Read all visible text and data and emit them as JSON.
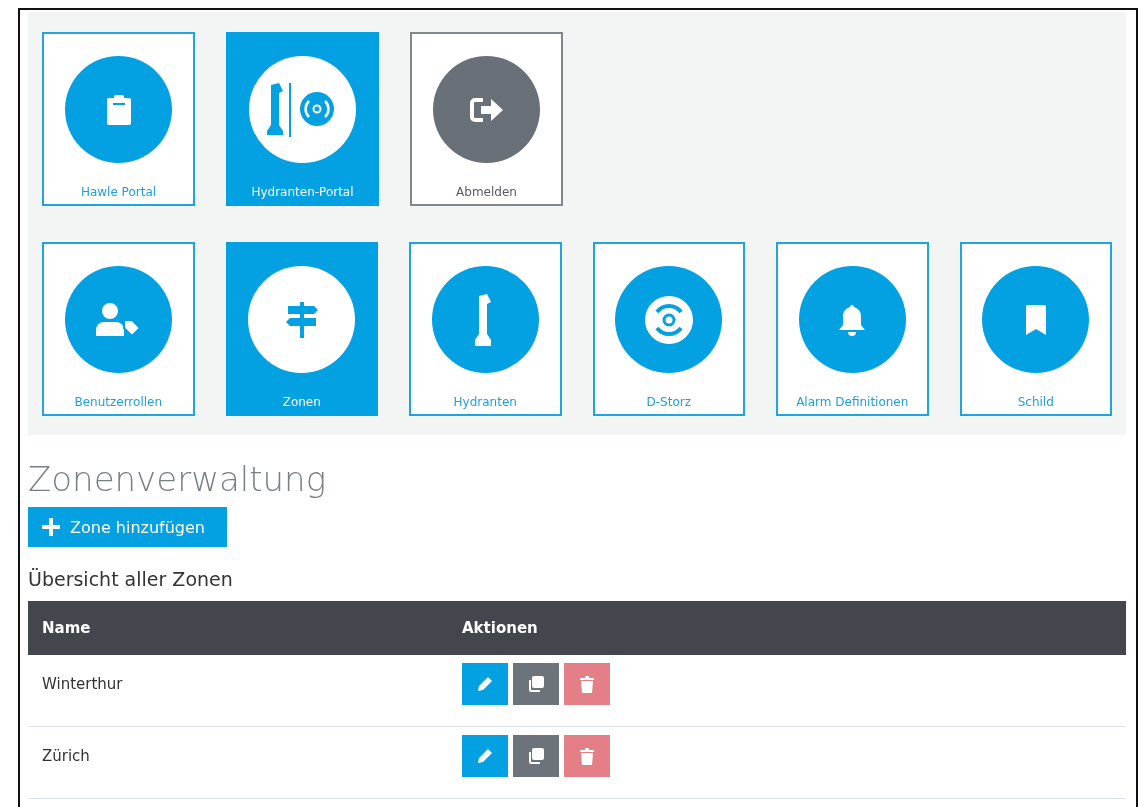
{
  "tile_rows": [
    {
      "tiles": [
        {
          "label": "Hawle Portal",
          "kind": "nav",
          "selected": false
        },
        {
          "label": "Hydranten-Portal",
          "kind": "nav",
          "selected": true
        },
        {
          "label": "Abmelden",
          "kind": "logout",
          "selected": false
        }
      ]
    },
    {
      "tiles": [
        {
          "label": "Benutzerrollen",
          "kind": "nav",
          "selected": false
        },
        {
          "label": "Zonen",
          "kind": "nav",
          "selected": true
        },
        {
          "label": "Hydranten",
          "kind": "nav",
          "selected": false
        },
        {
          "label": "D-Storz",
          "kind": "nav",
          "selected": false
        },
        {
          "label": "Alarm Definitionen",
          "kind": "nav",
          "selected": false
        },
        {
          "label": "Schild",
          "kind": "nav",
          "selected": false
        }
      ]
    }
  ],
  "page_title": "Zonenverwaltung",
  "add_button": {
    "label": "Zone hinzufügen"
  },
  "section_title": "Übersicht aller Zonen",
  "table": {
    "columns": [
      "Name",
      "Aktionen"
    ],
    "rows": [
      {
        "name": "Winterthur"
      },
      {
        "name": "Zürich"
      }
    ]
  }
}
